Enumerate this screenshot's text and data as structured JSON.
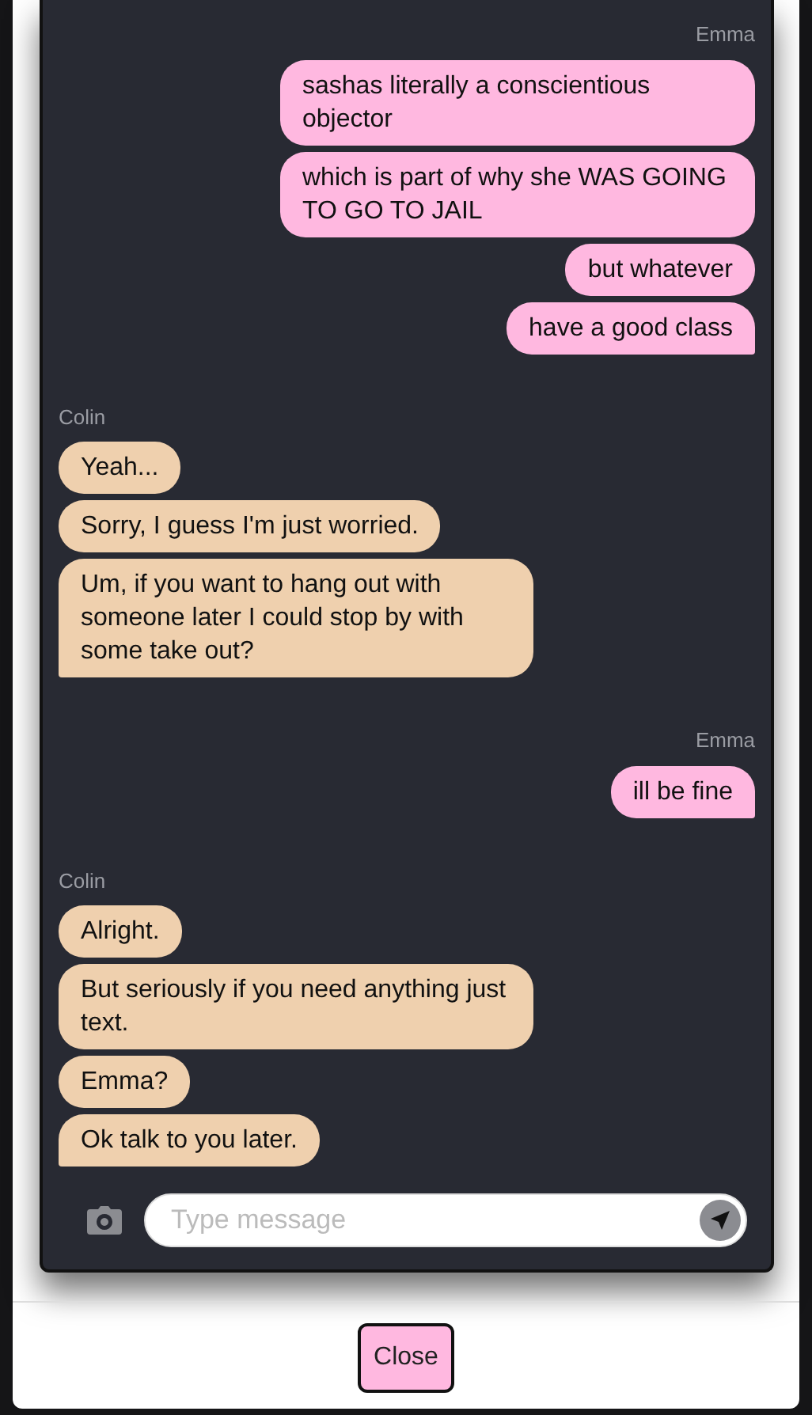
{
  "groups": [
    {
      "sender": "Emma",
      "kind": "sent",
      "messages": [
        "sashas literally a conscientious objector",
        "which is part of why she WAS GOING TO GO TO JAIL",
        "but whatever",
        "have a good class"
      ]
    },
    {
      "sender": "Colin",
      "kind": "received",
      "messages": [
        "Yeah...",
        "Sorry, I guess I'm just worried.",
        "Um, if you want to hang out with someone later I could stop by with some take out?"
      ]
    },
    {
      "sender": "Emma",
      "kind": "sent",
      "messages": [
        "ill be fine"
      ]
    },
    {
      "sender": "Colin",
      "kind": "received",
      "messages": [
        "Alright.",
        "But seriously if you need anything just text.",
        "Emma?",
        "Ok talk to you later."
      ]
    }
  ],
  "composer": {
    "placeholder": "Type message"
  },
  "footer": {
    "close_button": "Close"
  }
}
